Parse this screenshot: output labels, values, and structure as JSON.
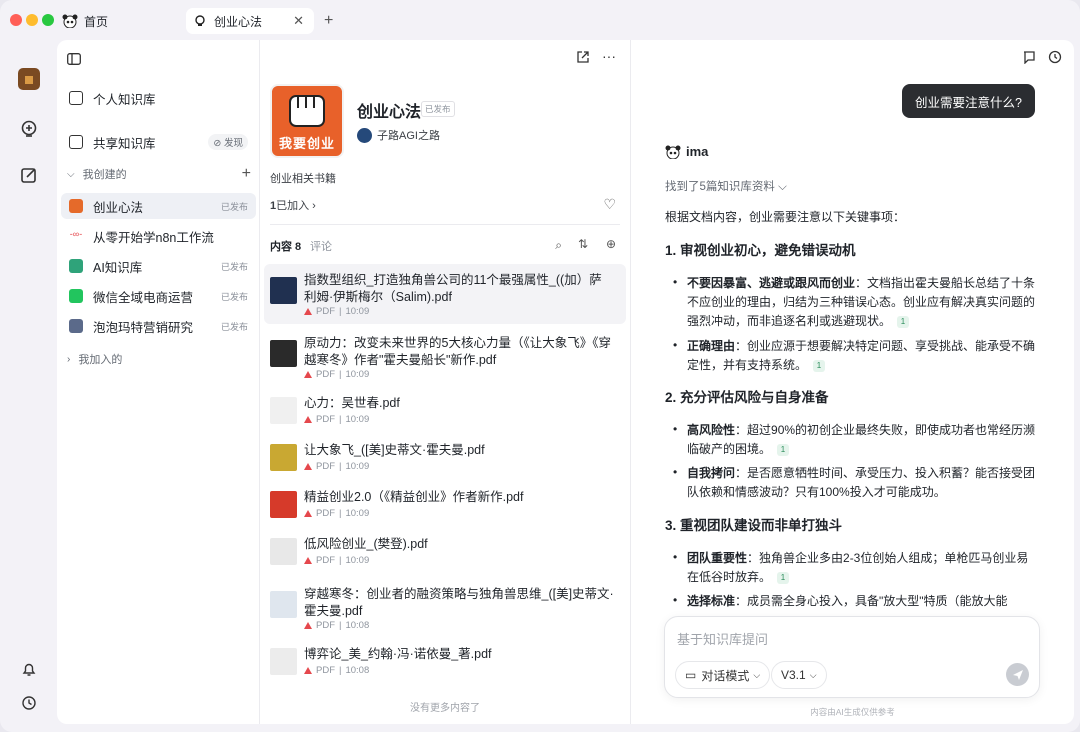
{
  "tabs": [
    {
      "label": "首页"
    },
    {
      "label": "创业心法"
    }
  ],
  "sidebar": {
    "personal": "个人知识库",
    "shared": "共享知识库",
    "discover": "发现",
    "created_header": "我创建的",
    "joined_header": "我加入的",
    "items": [
      {
        "label": "创业心法",
        "badge": "已发布"
      },
      {
        "label": "从零开始学n8n工作流",
        "badge": ""
      },
      {
        "label": "AI知识库",
        "badge": "已发布"
      },
      {
        "label": "微信全域电商运营",
        "badge": "已发布"
      },
      {
        "label": "泡泡玛特营销研究",
        "badge": "已发布"
      }
    ]
  },
  "kb": {
    "title": "创业心法",
    "status": "已发布",
    "author": "子路AGI之路",
    "desc": "创业相关书籍",
    "joined_count": "1",
    "joined_label": "已加入",
    "cover_text": "我要创业",
    "tab_content": "内容 8",
    "tab_comments": "评论",
    "docs": [
      {
        "title": "指数型组织_打造独角兽公司的11个最强属性_((加）萨利姆·伊斯梅尔（Salim).pdf",
        "type": "PDF",
        "time": "10:09"
      },
      {
        "title": "原动力：改变未来世界的5大核心力量（《让大象飞》《穿越寒冬》作者\"霍夫曼船长\"新作.pdf",
        "type": "PDF",
        "time": "10:09"
      },
      {
        "title": "心力：吴世春.pdf",
        "type": "PDF",
        "time": "10:09"
      },
      {
        "title": "让大象飞_([美]史蒂文·霍夫曼.pdf",
        "type": "PDF",
        "time": "10:09"
      },
      {
        "title": "精益创业2.0（《精益创业》作者新作.pdf",
        "type": "PDF",
        "time": "10:09"
      },
      {
        "title": "低风险创业_(樊登).pdf",
        "type": "PDF",
        "time": "10:09"
      },
      {
        "title": "穿越寒冬：创业者的融资策略与独角兽思维_([美]史蒂文·霍夫曼.pdf",
        "type": "PDF",
        "time": "10:08"
      },
      {
        "title": "博弈论_美_约翰·冯·诺依曼_著.pdf",
        "type": "PDF",
        "time": "10:08"
      }
    ],
    "end_text": "没有更多内容了"
  },
  "chat": {
    "question": "创业需要注意什么?",
    "bot_name": "ima",
    "found": "找到了5篇知识库资料",
    "intro": "根据文档内容，创业需要注意以下关键事项：",
    "s1": "1. 审视创业初心，避免错误动机",
    "s1b1k": "不要因暴富、逃避或跟风而创业",
    "s1b1": "：文档指出霍夫曼船长总结了十条不应创业的理由，归结为三种错误心态。创业应有解决真实问题的强烈冲动，而非追逐名利或逃避现状。",
    "s1b2k": "正确理由",
    "s1b2": "：创业应源于想要解决特定问题、享受挑战、能承受不确定性，并有支持系统。",
    "s2": "2. 充分评估风险与自身准备",
    "s2b1k": "高风险性",
    "s2b1": "：超过90%的初创企业最终失败，即使成功者也常经历濒临破产的困境。",
    "s2b2k": "自我拷问",
    "s2b2": "：是否愿意牺牲时间、承受压力、投入积蓄？能否接受团队依赖和情感波动？只有100%投入才可能成功。",
    "s3": "3. 重视团队建设而非单打独斗",
    "s3b1k": "团队重要性",
    "s3b1": "：独角兽企业多由2-3位创始人组成；单枪匹马创业易在低谷时放弃。",
    "s3b2k": "选择标准",
    "s3b2": "：成员需全身心投入，具备\"放大型\"特质（能放大能量），",
    "cite": "1",
    "input_placeholder": "基于知识库提问",
    "mode": "对话模式",
    "version": "V3.1",
    "footer": "内容由AI生成仅供参考"
  }
}
